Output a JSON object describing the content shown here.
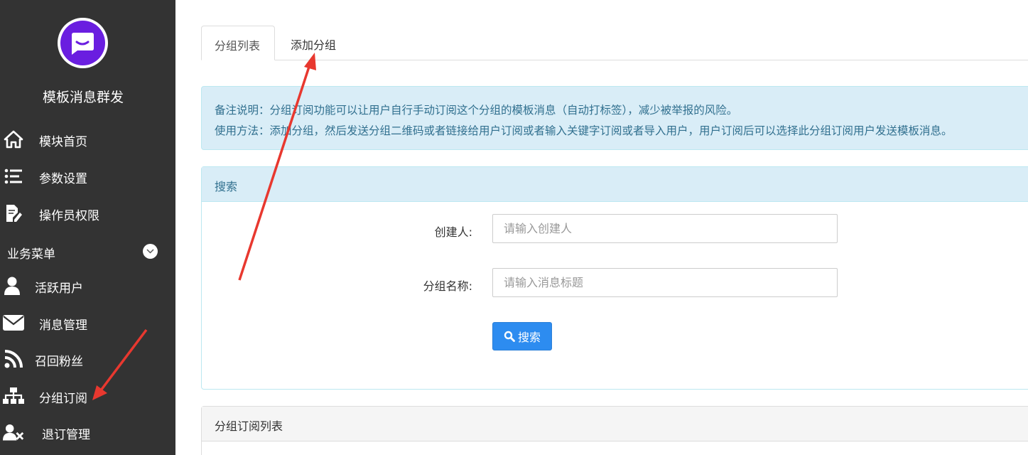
{
  "sidebar": {
    "app_title": "模板消息群发",
    "logo_icon": "chat-smile-icon",
    "items_top": [
      {
        "label": "模块首页",
        "icon": "home-icon"
      },
      {
        "label": "参数设置",
        "icon": "list-settings-icon"
      },
      {
        "label": "操作员权限",
        "icon": "edit-document-icon"
      }
    ],
    "section_label": "业务菜单",
    "section_toggle_icon": "chevron-down-icon",
    "items_business": [
      {
        "label": "活跃用户",
        "icon": "user-icon"
      },
      {
        "label": "消息管理",
        "icon": "envelope-icon"
      },
      {
        "label": "召回粉丝",
        "icon": "rss-icon"
      },
      {
        "label": "分组订阅",
        "icon": "sitemap-icon"
      },
      {
        "label": "退订管理",
        "icon": "user-remove-icon"
      }
    ]
  },
  "tabs": [
    {
      "label": "分组列表",
      "active": true
    },
    {
      "label": "添加分组",
      "active": false
    }
  ],
  "alert": {
    "line1": "备注说明：分组订阅功能可以让用户自行手动订阅这个分组的模板消息（自动打标签），减少被举报的风险。",
    "line2": "使用方法：添加分组，然后发送分组二维码或者链接给用户订阅或者输入关键字订阅或者导入用户，用户订阅后可以选择此分组订阅用户发送模板消息。"
  },
  "search_panel": {
    "heading": "搜索",
    "creator_label": "创建人:",
    "creator_placeholder": "请输入创建人",
    "group_name_label": "分组名称:",
    "group_name_placeholder": "请输入消息标题",
    "search_button": "搜索",
    "search_icon": "search-icon"
  },
  "list_panel": {
    "heading": "分组订阅列表"
  },
  "colors": {
    "sidebar_bg": "#333333",
    "logo_purple": "#6a1ee0",
    "alert_bg": "#d9edf7",
    "alert_text": "#31708f",
    "primary_button": "#2d8cf0",
    "annotation_arrow": "#e8382f"
  }
}
